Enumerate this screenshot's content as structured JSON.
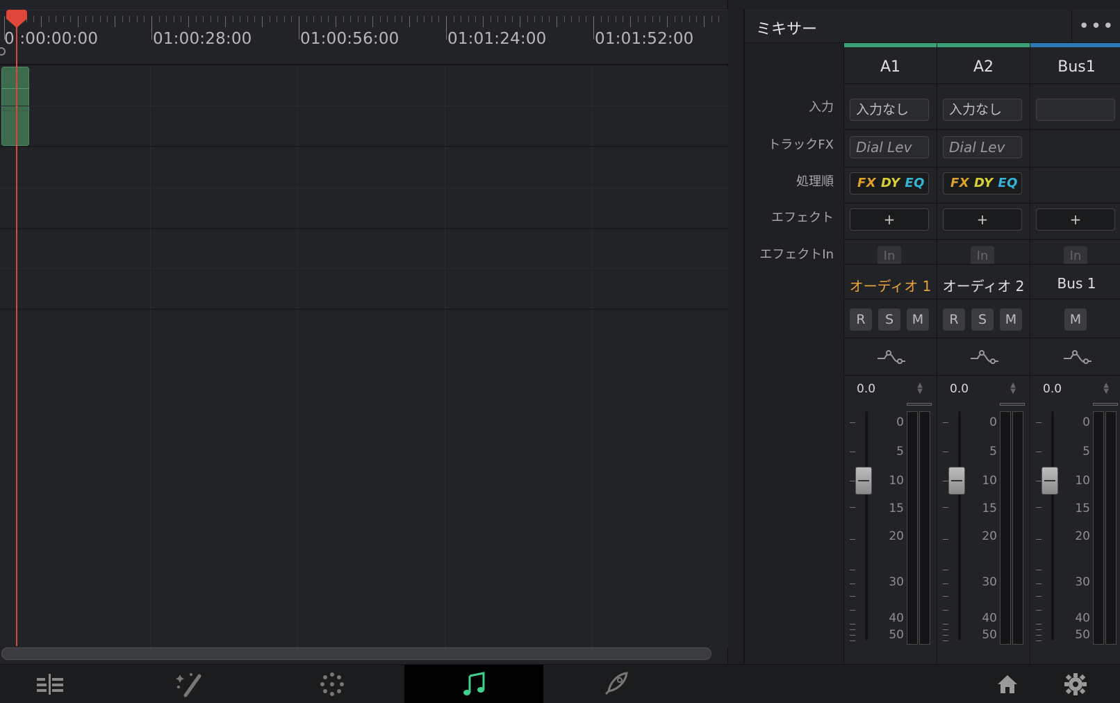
{
  "timeline": {
    "timecodes": [
      "0 :00:00:00",
      "01:00:28:00",
      "01:00:56:00",
      "01:01:24:00",
      "01:01:52:00"
    ]
  },
  "mixer": {
    "title": "ミキサー",
    "menu": "•••",
    "row_labels": {
      "input": "入力",
      "track_fx": "トラックFX",
      "order": "処理順",
      "effect": "エフェクト",
      "effect_in": "エフェクトIn"
    },
    "strips": [
      {
        "id": "A1",
        "color": "#3aa176",
        "input": "入力なし",
        "track_fx": "Dial Lev",
        "order": {
          "fx": "FX",
          "dy": "DY",
          "eq": "EQ"
        },
        "add": "+",
        "in": "In",
        "track_name": "オーディオ 1",
        "track_name_color": "#e8a33a",
        "buttons": [
          "R",
          "S",
          "M"
        ],
        "volume": "0.0"
      },
      {
        "id": "A2",
        "color": "#3aa176",
        "input": "入力なし",
        "track_fx": "Dial Lev",
        "order": {
          "fx": "FX",
          "dy": "DY",
          "eq": "EQ"
        },
        "add": "+",
        "in": "In",
        "track_name": "オーディオ 2",
        "track_name_color": "#e0e0e0",
        "buttons": [
          "R",
          "S",
          "M"
        ],
        "volume": "0.0"
      },
      {
        "id": "Bus1",
        "color": "#2a78b4",
        "input": "",
        "track_fx": "",
        "order": null,
        "add": "+",
        "in": "In",
        "track_name": "Bus 1",
        "track_name_color": "#e0e0e0",
        "buttons": [
          "M"
        ],
        "volume": "0.0"
      }
    ],
    "scale": [
      "0",
      "5",
      "10",
      "15",
      "20",
      "30",
      "40",
      "50"
    ],
    "fader_level_db": 10
  },
  "bottom_nav": {
    "items": [
      {
        "name": "cut-page",
        "icon": "timeline-icon"
      },
      {
        "name": "fairlight-effects",
        "icon": "magic-wand-icon"
      },
      {
        "name": "color-page",
        "icon": "dots-wheel-icon"
      },
      {
        "name": "fairlight-page",
        "icon": "music-note-icon",
        "active": true
      },
      {
        "name": "deliver-page",
        "icon": "rocket-icon"
      }
    ],
    "home_icon": "home-icon",
    "settings_icon": "gear-icon",
    "active_color": "#3fcf8e"
  }
}
